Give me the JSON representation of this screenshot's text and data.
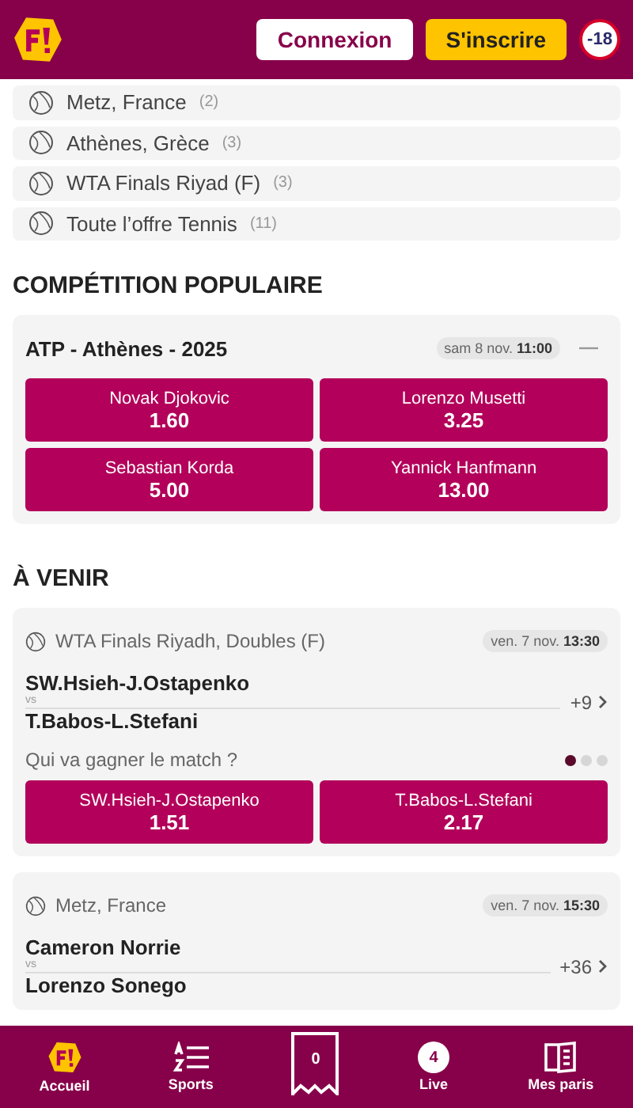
{
  "header": {
    "login_button": "Connexion",
    "signup_button": "S'inscrire",
    "age_badge": "-18"
  },
  "tournaments": [
    {
      "name": "Metz, France",
      "count": "(2)"
    },
    {
      "name": "Athènes, Grèce",
      "count": "(3)"
    },
    {
      "name": "WTA Finals Riyad (F)",
      "count": "(3)"
    },
    {
      "name": "Toute l’offre Tennis",
      "count": "(11)"
    }
  ],
  "popular": {
    "title": "COMPÉTITION POPULAIRE",
    "competition": "ATP - Athènes - 2025",
    "date": "sam  8 nov. **11:00**",
    "odds": [
      {
        "player": "Novak Djokovic",
        "odd": "1.60"
      },
      {
        "player": "Lorenzo Musetti",
        "odd": "3.25"
      },
      {
        "player": "Sebastian Korda",
        "odd": "5.00"
      },
      {
        "player": "Yannick Hanfmann",
        "odd": "13.00"
      }
    ]
  },
  "upcoming": {
    "title": "À VENIR",
    "matches": [
      {
        "tournament": "WTA Finals Riyadh, Doubles (F)",
        "date": "ven. 7 nov. **13:30**",
        "home": "SW.Hsieh-J.Ostapenko",
        "vs": "vs",
        "away": "T.Babos-L.Stefani",
        "more": "+9",
        "question": "Qui va gagner le match ?",
        "dots": [
          {
            "selected": true
          },
          {
            "selected": false
          },
          {
            "selected": false
          }
        ],
        "odds": [
          {
            "player": "SW.Hsieh-J.Ostapenko",
            "odd": "1.51"
          },
          {
            "player": "T.Babos-L.Stefani",
            "odd": "2.17"
          }
        ]
      },
      {
        "tournament": "Metz, France",
        "date": "ven. 7 nov. **15:30**",
        "home": "Cameron Norrie",
        "vs": "vs",
        "away": "Lorenzo Sonego",
        "more": "+36"
      }
    ]
  },
  "nav": [
    {
      "kind": "home",
      "label": "Accueil"
    },
    {
      "kind": "sports",
      "label": "Sports"
    },
    {
      "kind": "slip",
      "count": "0"
    },
    {
      "kind": "live",
      "label": "Live",
      "count": "4"
    },
    {
      "kind": "bets",
      "label": "Mes paris"
    }
  ]
}
